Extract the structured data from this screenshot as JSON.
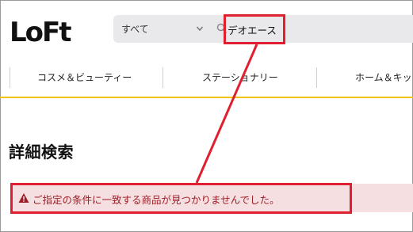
{
  "header": {
    "logo_text": "LoFt",
    "search": {
      "category_value": "すべて",
      "query_value": "デオエース"
    }
  },
  "nav": {
    "items": [
      {
        "label": "コスメ＆ビューティー"
      },
      {
        "label": "ステーショナリー"
      },
      {
        "label": "ホーム＆キッ"
      }
    ]
  },
  "page": {
    "title": "詳細検索",
    "alert_message": "ご指定の条件に一致する商品が見つかりませんでした。"
  },
  "colors": {
    "accent_yellow": "#f2c200",
    "alert_bg": "#f6dfe0",
    "alert_text": "#9b1f28",
    "annotation_red": "#e02030"
  },
  "icons": [
    "chevron-down-icon",
    "search-icon",
    "warning-icon"
  ]
}
